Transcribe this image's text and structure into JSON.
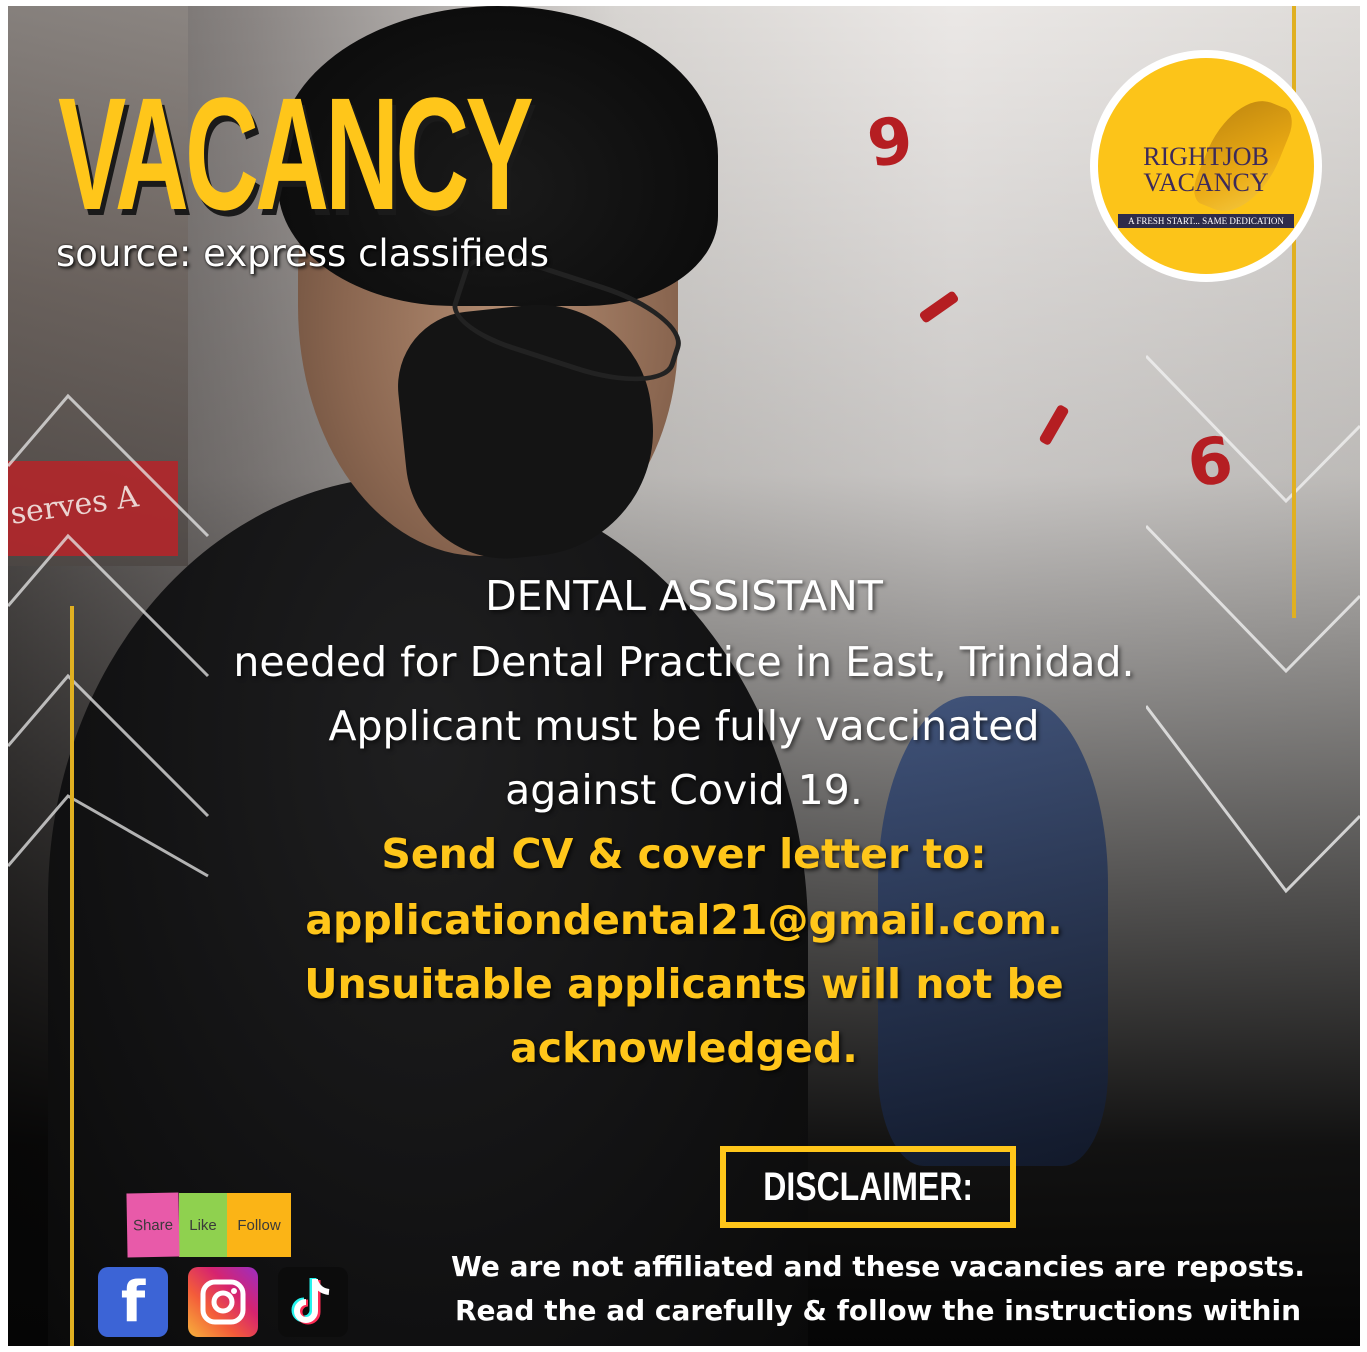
{
  "header": {
    "title": "VACANCY",
    "source": "source: express classifieds"
  },
  "logo": {
    "line1": "RIGHTJOB",
    "line2": "VACANCY",
    "tagline": "A FRESH START... SAME DEDICATION"
  },
  "background": {
    "wall_text": "serves A",
    "clock_nine": "9",
    "clock_six": "6"
  },
  "ad": {
    "white_lines": [
      "DENTAL ASSISTANT",
      "needed for Dental Practice in East, Trinidad.",
      "Applicant must be fully vaccinated",
      "against Covid 19."
    ],
    "yellow_lines": [
      "Send CV & cover letter to:",
      "applicationdental21@gmail.com.",
      "Unsuitable applicants will not be",
      "acknowledged."
    ]
  },
  "disclaimer": {
    "label": "DISCLAIMER:",
    "lines": [
      "We are not affiliated and these vacancies are reposts.",
      "Read the ad carefully & follow the instructions within"
    ]
  },
  "social": {
    "stickers": [
      "Share",
      "Like",
      "Follow"
    ],
    "icons": [
      "facebook-icon",
      "instagram-icon",
      "tiktok-icon"
    ],
    "facebook_glyph": "f"
  },
  "colors": {
    "accent_yellow": "#ffc61a",
    "clock_red": "#b51e22",
    "facebook_blue": "#3c64d6"
  }
}
